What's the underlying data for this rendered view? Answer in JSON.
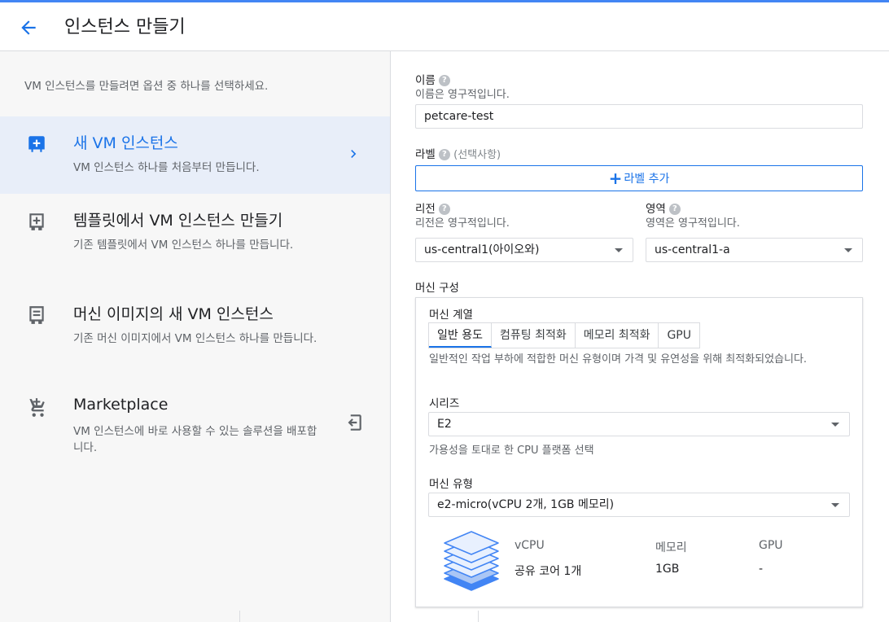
{
  "header": {
    "title": "인스턴스 만들기"
  },
  "left": {
    "intro": "VM 인스턴스를 만들려면 옵션 중 하나를 선택하세요.",
    "options": [
      {
        "title": "새 VM 인스턴스",
        "desc": "VM 인스턴스 하나를 처음부터 만듭니다."
      },
      {
        "title": "템플릿에서 VM 인스턴스 만들기",
        "desc": "기존 템플릿에서 VM 인스턴스 하나를 만듭니다."
      },
      {
        "title": "머신 이미지의 새 VM 인스턴스",
        "desc": "기존 머신 이미지에서 VM 인스턴스 하나를 만듭니다."
      },
      {
        "title": "Marketplace",
        "desc": "VM 인스턴스에 바로 사용할 수 있는 솔루션을 배포합니다."
      }
    ]
  },
  "form": {
    "name": {
      "label": "이름",
      "sub": "이름은 영구적입니다.",
      "value": "petcare-test"
    },
    "labels": {
      "label": "라벨",
      "optional": "(선택사항)",
      "add_button": "라벨 추가"
    },
    "region": {
      "label": "리전",
      "sub": "리전은 영구적입니다.",
      "value": "us-central1(아이오와)"
    },
    "zone": {
      "label": "영역",
      "sub": "영역은 영구적입니다.",
      "value": "us-central1-a"
    },
    "machine_config": {
      "label": "머신 구성",
      "family_label": "머신 계열",
      "tabs": [
        "일반 용도",
        "컴퓨팅 최적화",
        "메모리 최적화",
        "GPU"
      ],
      "active_tab": "일반 용도",
      "family_desc": "일반적인 작업 부하에 적합한 머신 유형이며 가격 및 유연성을 위해 최적화되었습니다.",
      "series": {
        "label": "시리즈",
        "value": "E2",
        "sub": "가용성을 토대로 한 CPU 플랫폼 선택"
      },
      "machine_type": {
        "label": "머신 유형",
        "value": "e2-micro(vCPU 2개, 1GB 메모리)"
      },
      "specs": {
        "headers": [
          "vCPU",
          "메모리",
          "GPU"
        ],
        "values": [
          "공유 코어 1개",
          "1GB",
          "-"
        ]
      }
    }
  },
  "colors": {
    "accent": "#1a73e8",
    "selected_bg": "#e8eef9",
    "top_bar": "#4285f4"
  }
}
